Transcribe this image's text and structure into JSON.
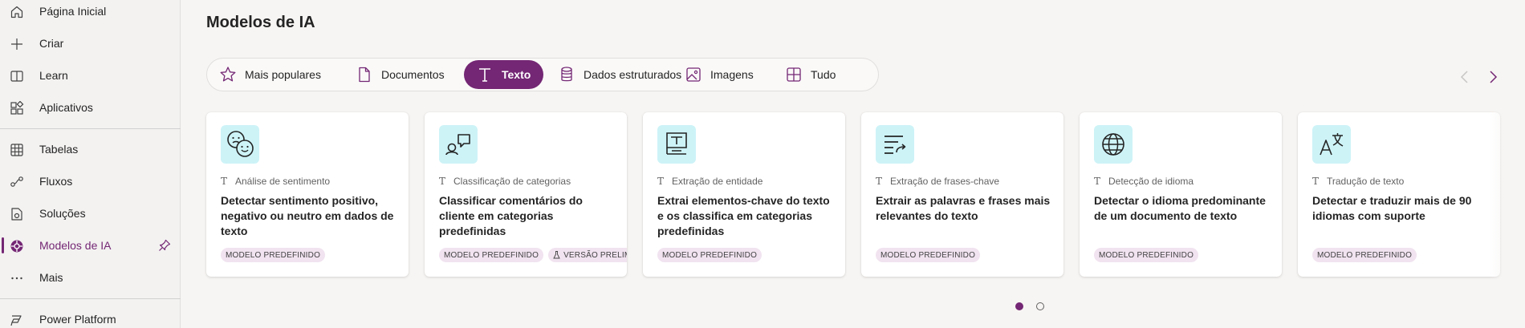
{
  "sidebar": {
    "items": [
      {
        "label": "Página Inicial",
        "icon": "home-icon"
      },
      {
        "label": "Criar",
        "icon": "plus-icon"
      },
      {
        "label": "Learn",
        "icon": "book-icon"
      },
      {
        "label": "Aplicativos",
        "icon": "apps-icon"
      },
      {
        "label": "Tabelas",
        "icon": "table-icon"
      },
      {
        "label": "Fluxos",
        "icon": "flow-icon"
      },
      {
        "label": "Soluções",
        "icon": "solutions-icon"
      },
      {
        "label": "Modelos de IA",
        "icon": "ai-models-icon",
        "active": true
      },
      {
        "label": "Mais",
        "icon": "more-icon"
      },
      {
        "label": "Power Platform",
        "icon": "power-platform-icon"
      }
    ]
  },
  "main": {
    "title": "Modelos de IA",
    "tabs": [
      {
        "label": "Mais populares",
        "icon": "star-icon"
      },
      {
        "label": "Documentos",
        "icon": "document-icon"
      },
      {
        "label": "Texto",
        "icon": "text-icon",
        "active": true
      },
      {
        "label": "Dados estruturados",
        "icon": "database-icon"
      },
      {
        "label": "Imagens",
        "icon": "image-icon"
      },
      {
        "label": "Tudo",
        "icon": "grid-icon"
      }
    ],
    "cards": [
      {
        "category": "Análise de sentimento",
        "description": "Detectar sentimento positivo, negativo ou neutro em dados de texto",
        "badges": [
          "MODELO PREDEFINIDO"
        ],
        "icon": "sentiment-icon"
      },
      {
        "category": "Classificação de categorias",
        "description": "Classificar comentários do cliente em categorias predefinidas",
        "badges": [
          "MODELO PREDEFINIDO",
          "VERSÃO PRELIMINAR"
        ],
        "icon": "category-classification-icon"
      },
      {
        "category": "Extração de entidade",
        "description": "Extrai elementos-chave do texto e os classifica em categorias predefinidas",
        "badges": [
          "MODELO PREDEFINIDO"
        ],
        "icon": "entity-extraction-icon"
      },
      {
        "category": "Extração de frases-chave",
        "description": "Extrair as palavras e frases mais relevantes do texto",
        "badges": [
          "MODELO PREDEFINIDO"
        ],
        "icon": "key-phrase-icon"
      },
      {
        "category": "Detecção de idioma",
        "description": "Detectar o idioma predominante de um documento de texto",
        "badges": [
          "MODELO PREDEFINIDO"
        ],
        "icon": "globe-icon"
      },
      {
        "category": "Tradução de texto",
        "description": "Detectar e traduzir mais de 90 idiomas com suporte",
        "badges": [
          "MODELO PREDEFINIDO"
        ],
        "icon": "translate-icon"
      }
    ],
    "pagination": {
      "pages": 2,
      "current": 1
    }
  },
  "colors": {
    "accent": "#742774",
    "icon_tile": "#cdf3f7",
    "badge_bg": "#f1e3f0"
  }
}
